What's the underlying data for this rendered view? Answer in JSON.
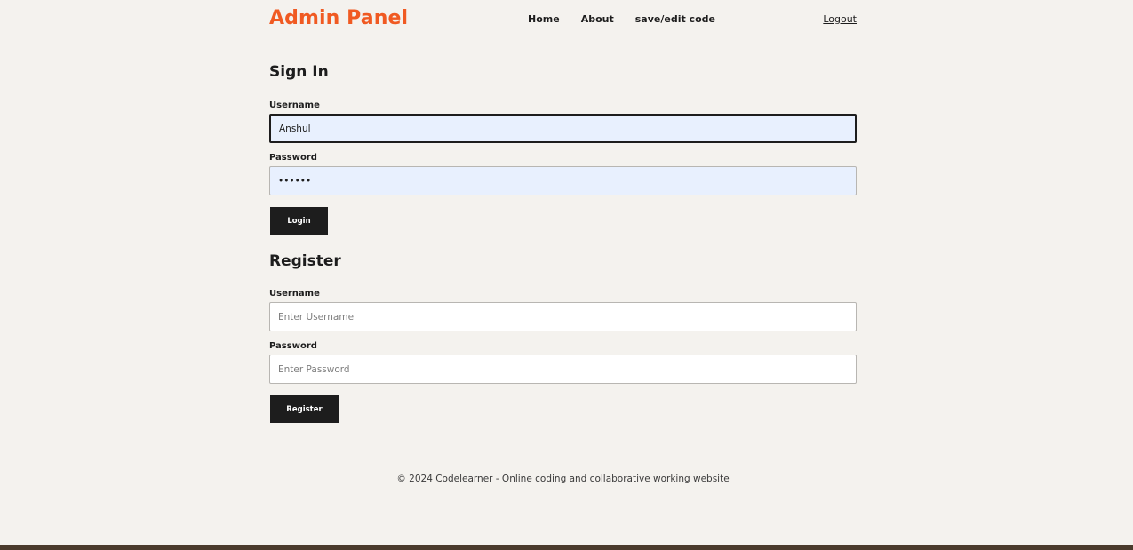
{
  "header": {
    "brand": "Admin Panel",
    "nav": [
      "Home",
      "About",
      "save/edit code"
    ],
    "logout": "Logout"
  },
  "signin": {
    "title": "Sign In",
    "username_label": "Username",
    "username_value": "Anshul",
    "password_label": "Password",
    "password_value": "••••••",
    "button": "Login"
  },
  "register": {
    "title": "Register",
    "username_label": "Username",
    "username_placeholder": "Enter Username",
    "password_label": "Password",
    "password_placeholder": "Enter Password",
    "button": "Register"
  },
  "footer": {
    "text": "© 2024 Codelearner - Online coding and collaborative working website"
  },
  "colors": {
    "brand": "#f05a22",
    "background": "#f4f2ee",
    "button": "#1d1d1d",
    "autofill": "#e8f0fe"
  }
}
